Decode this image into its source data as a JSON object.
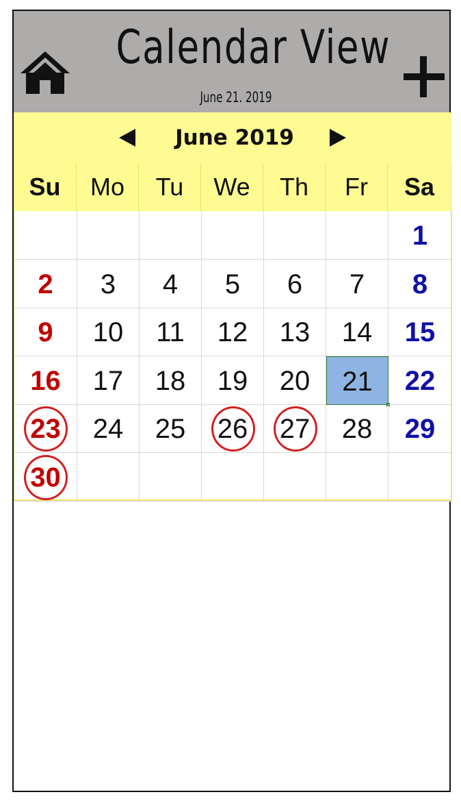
{
  "header": {
    "title": "Calendar View",
    "current_date": "June 21. 2019",
    "home_icon": "home-icon",
    "add_icon": "plus-icon"
  },
  "calendar": {
    "month_label": "June 2019",
    "prev_icon": "triangle-left-icon",
    "next_icon": "triangle-right-icon",
    "weekdays": [
      "Su",
      "Mo",
      "Tu",
      "We",
      "Th",
      "Fr",
      "Sa"
    ],
    "selected_day": 21,
    "circled_days": [
      23,
      26,
      27,
      30
    ],
    "weeks": [
      [
        "",
        "",
        "",
        "",
        "",
        "",
        "1"
      ],
      [
        "2",
        "3",
        "4",
        "5",
        "6",
        "7",
        "8"
      ],
      [
        "9",
        "10",
        "11",
        "12",
        "13",
        "14",
        "15"
      ],
      [
        "16",
        "17",
        "18",
        "19",
        "20",
        "21",
        "22"
      ],
      [
        "23",
        "24",
        "25",
        "26",
        "27",
        "28",
        "29"
      ],
      [
        "30",
        "",
        "",
        "",
        "",
        "",
        ""
      ]
    ]
  },
  "colors": {
    "header_bg": "#aeabab",
    "calendar_bg": "#fefb92",
    "sunday": "#c00000",
    "saturday": "#1010a8",
    "selected": "#8eb4e3",
    "circle": "#d21f1f"
  }
}
